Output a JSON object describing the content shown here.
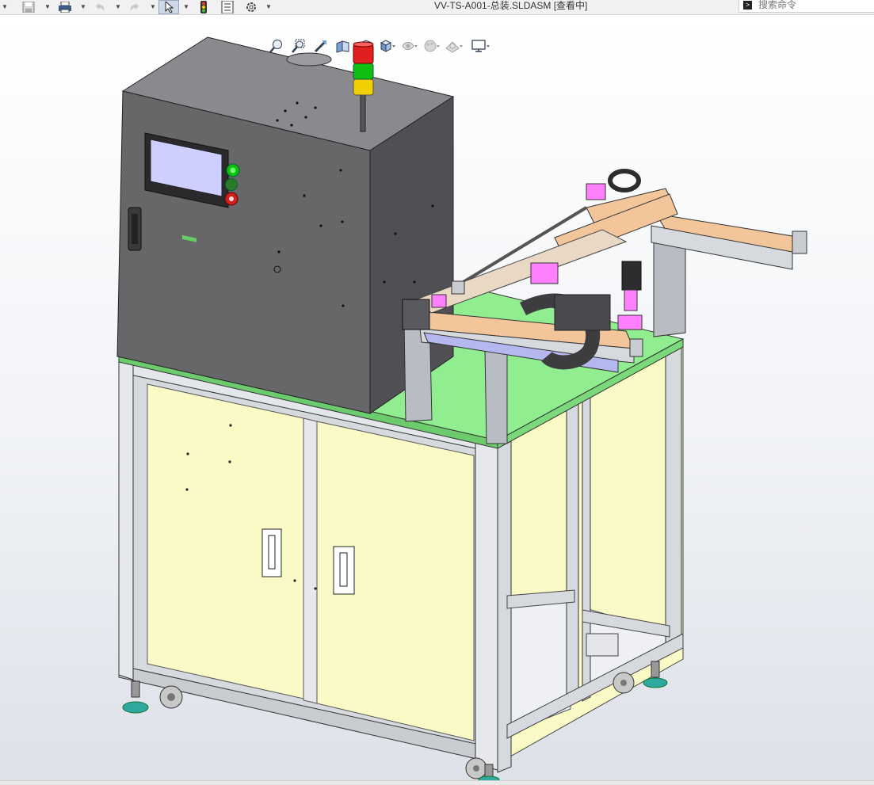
{
  "titlebar": {
    "document_title": "VV-TS-A001-总装.SLDASM [查看中]",
    "search_placeholder": "搜索命令"
  },
  "toolbar": {
    "items": [
      "save-icon",
      "print-icon",
      "undo-icon",
      "redo-icon",
      "select-arrow-icon",
      "rebuild-traffic-light-icon",
      "file-properties-icon",
      "options-gear-icon"
    ]
  },
  "headsup_toolbar": {
    "items": [
      "zoom-to-fit-icon",
      "zoom-to-area-icon",
      "previous-view-icon",
      "section-view-icon",
      "view-orientation-icon",
      "display-style-icon",
      "hide-show-items-icon",
      "edit-appearance-icon",
      "apply-scene-icon",
      "view-settings-icon"
    ]
  },
  "colors": {
    "cabinet": "#606064",
    "table_top": "#90ee90",
    "door_panel": "#fafac6",
    "frame": "#d6d9dd",
    "screen": "#cfcfff",
    "beam": "#f2c59a",
    "stack_light_red": "#e02020",
    "stack_light_green": "#10c010",
    "stack_light_yellow": "#f0d000",
    "rail_blue": "#b5b8ef",
    "pink_part": "#ff80ff"
  }
}
